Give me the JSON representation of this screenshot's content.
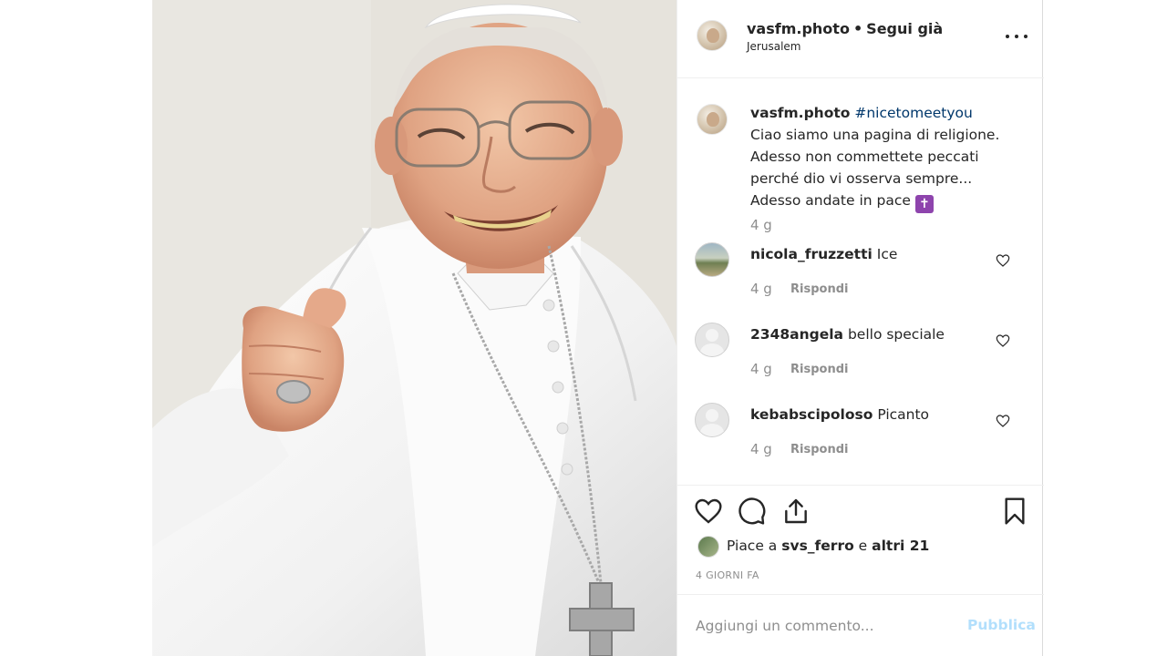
{
  "post": {
    "username": "vasfm.photo",
    "separator": "•",
    "follow_status": "Segui già",
    "location": "Jerusalem",
    "more_icon": "more-horizontal-icon"
  },
  "caption": {
    "username": "vasfm.photo",
    "hashtag": "#nicetomeetyou",
    "text": "Ciao siamo una pagina di religione. Adesso non commettete peccati perché dio vi osserva sempre... Adesso andate in pace",
    "emoji": "✝",
    "time": "4 g"
  },
  "comments": [
    {
      "username": "nicola_fruzzetti",
      "text": "Ice",
      "time": "4 g",
      "reply": "Rispondi"
    },
    {
      "username": "2348angela",
      "text": "bello speciale",
      "time": "4 g",
      "reply": "Rispondi"
    },
    {
      "username": "kebabscipoloso",
      "text": "Picanto",
      "time": "4 g",
      "reply": "Rispondi"
    }
  ],
  "actions": {
    "like_icon": "heart-icon",
    "comment_icon": "comment-icon",
    "share_icon": "share-icon",
    "save_icon": "bookmark-icon"
  },
  "likes": {
    "prefix": "Piace a",
    "user": "svs_ferro",
    "suffix": "e",
    "others": "altri 21"
  },
  "date": "4 GIORNI FA",
  "comment_box": {
    "placeholder": "Aggiungi un commento...",
    "publish_label": "Pubblica"
  },
  "colors": {
    "text": "#262626",
    "muted": "#8e8e8e",
    "hashtag": "#00376b",
    "publish_disabled": "#b2dffc"
  }
}
